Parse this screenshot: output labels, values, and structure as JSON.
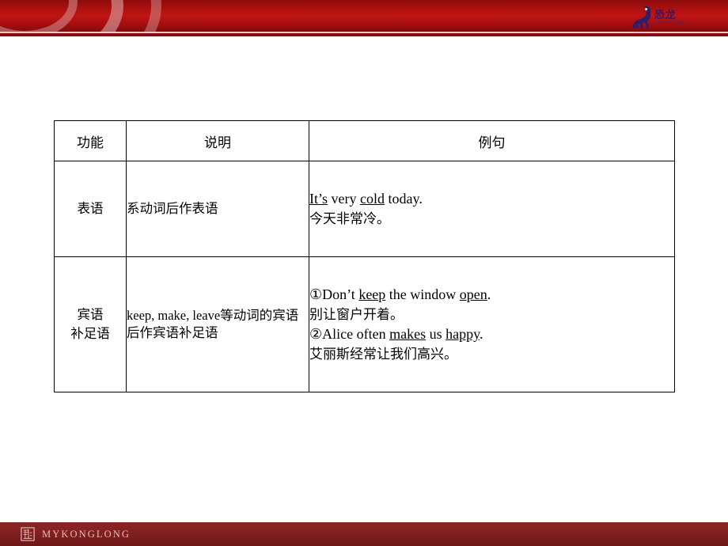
{
  "header": {
    "logo": {
      "icon": "dinosaur-icon",
      "chinese_text": "恐龙",
      "english_text": "MYKONGLONG"
    }
  },
  "table": {
    "columns": [
      "功能",
      "说明",
      "例句"
    ],
    "rows": [
      {
        "function": "表语",
        "description": "系动词后作表语",
        "examples": [
          {
            "marker": "",
            "english_parts": [
              {
                "text": "It’s",
                "underline": true
              },
              {
                "text": " very ",
                "underline": false
              },
              {
                "text": "cold",
                "underline": true
              },
              {
                "text": " today.",
                "underline": false
              }
            ],
            "english_plain": "It’s very cold today.",
            "chinese": "今天非常冷。"
          }
        ]
      },
      {
        "function_line1": "宾语",
        "function_line2": "补足语",
        "description_latin": "keep, make, leave",
        "description_cn": "等动词的宾语后作宾语补足语",
        "examples": [
          {
            "marker": "①",
            "english_parts": [
              {
                "text": "Don’t ",
                "underline": false
              },
              {
                "text": "keep",
                "underline": true
              },
              {
                "text": " the window ",
                "underline": false
              },
              {
                "text": "open",
                "underline": true
              },
              {
                "text": ".",
                "underline": false
              }
            ],
            "english_plain": "①Don’t keep the window open.",
            "chinese": "别让窗户开着。"
          },
          {
            "marker": "②",
            "english_parts": [
              {
                "text": "Alice often ",
                "underline": false
              },
              {
                "text": "makes",
                "underline": true
              },
              {
                "text": " us ",
                "underline": false
              },
              {
                "text": "happy",
                "underline": true
              },
              {
                "text": ".",
                "underline": false
              }
            ],
            "english_plain": "②Alice often makes us happy.",
            "chinese": "艾丽斯经常让我们高兴。"
          }
        ]
      }
    ]
  },
  "footer": {
    "brand": "MYKONGLONG",
    "mark": "kongLong-square-icon"
  },
  "colors": {
    "banner_red": "#a60f0f",
    "banner_dark": "#8c0a0a",
    "banner_arc": "#d9a0a0",
    "footer_red": "#7e1e1e",
    "footer_text": "#e8bcbc",
    "logo_navy": "#2b1f6b",
    "table_border": "#000000"
  }
}
